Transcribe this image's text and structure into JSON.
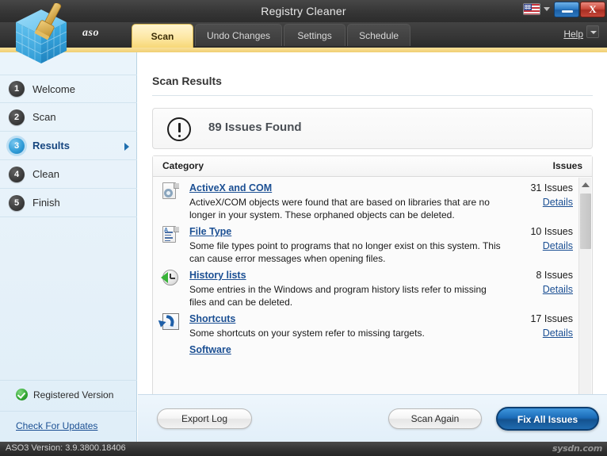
{
  "window": {
    "title": "Registry Cleaner",
    "minimize_label": "–",
    "close_label": "X",
    "language_icon": "us-flag-icon"
  },
  "tabbar": {
    "brand": "aso",
    "help_label": "Help",
    "tabs": [
      {
        "label": "Scan",
        "active": true
      },
      {
        "label": "Undo Changes",
        "active": false
      },
      {
        "label": "Settings",
        "active": false
      },
      {
        "label": "Schedule",
        "active": false
      }
    ]
  },
  "sidebar": {
    "items": [
      {
        "num": "1",
        "label": "Welcome",
        "active": false
      },
      {
        "num": "2",
        "label": "Scan",
        "active": false
      },
      {
        "num": "3",
        "label": "Results",
        "active": true
      },
      {
        "num": "4",
        "label": "Clean",
        "active": false
      },
      {
        "num": "5",
        "label": "Finish",
        "active": false
      }
    ],
    "registered_label": "Registered Version",
    "updates_label": "Check For Updates"
  },
  "main": {
    "page_title": "Scan Results",
    "summary": "89 Issues Found",
    "table_headers": {
      "category": "Category",
      "issues": "Issues"
    },
    "rows": [
      {
        "icon": "activex-document-gear-icon",
        "name": "ActiveX and COM",
        "description": "ActiveX/COM objects were found that are based on libraries that are no longer in your system. These orphaned objects can be deleted.",
        "count": "31 Issues",
        "details": "Details"
      },
      {
        "icon": "file-type-document-icon",
        "name": "File Type",
        "description": "Some file types point to programs that no longer exist on this system. This can cause error messages when opening files.",
        "count": "10 Issues",
        "details": "Details"
      },
      {
        "icon": "history-clock-icon",
        "name": "History lists",
        "description": "Some entries in the Windows and program history lists refer to missing files and can be deleted.",
        "count": "8 Issues",
        "details": "Details"
      },
      {
        "icon": "shortcut-arrow-icon",
        "name": "Shortcuts",
        "description": "Some shortcuts on your system refer to missing targets.",
        "count": "17 Issues",
        "details": "Details"
      },
      {
        "icon": "software-icon",
        "name": "Software",
        "description": "",
        "count": "",
        "details": ""
      }
    ]
  },
  "footer": {
    "export_label": "Export Log",
    "scan_again_label": "Scan Again",
    "fix_all_label": "Fix All Issues"
  },
  "statusbar": {
    "version": "ASO3 Version: 3.9.3800.18406",
    "watermark": "sysdn.com"
  },
  "colors": {
    "accent_blue": "#1b6cb8",
    "link_blue": "#1b4f93",
    "tab_active": "#f7d877",
    "sidebar_bg": "#e6f1f9",
    "titlebar": "#373737"
  }
}
